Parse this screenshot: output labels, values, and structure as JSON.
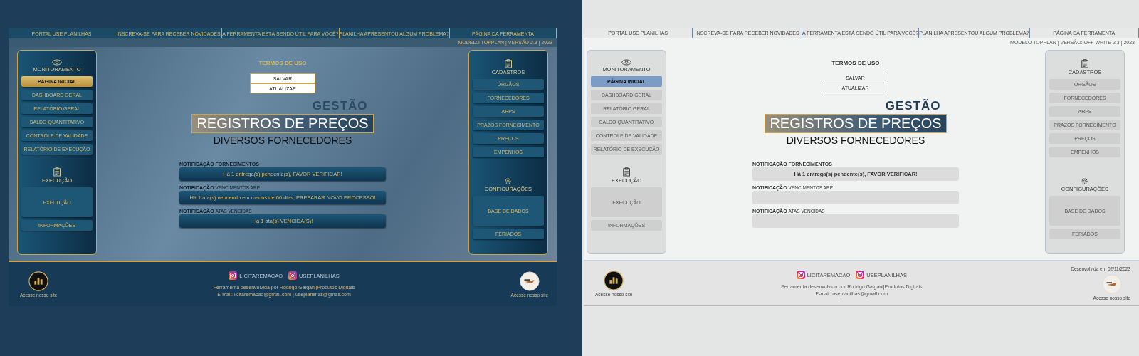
{
  "screens": [
    {
      "kind": "dark",
      "links": [
        "PORTAL USE PLANILHAS",
        "INSCREVA-SE PARA RECEBER NOVIDADES",
        "A FERRAMENTA ESTÁ SENDO ÚTIL PARA VOCÊ?",
        "PLANILHA APRESENTOU ALGUM PROBLEMA?",
        "PÁGINA DA FERRAMENTA"
      ],
      "version": "MODELO TOPPLAN | VERSÃO 2.3 | 2023",
      "monitoring": {
        "title": "MONITORAMENTO",
        "items": [
          {
            "label": "PÁGINA INICIAL",
            "selected": true
          },
          {
            "label": "DASHBOARD GERAL",
            "selected": false
          },
          {
            "label": "RELATÓRIO GERAL",
            "selected": false
          },
          {
            "label": "SALDO QUANTITATIVO",
            "selected": false
          },
          {
            "label": "CONTROLE DE VALIDADE",
            "selected": false
          },
          {
            "label": "RELATÓRIO DE EXECUÇÃO",
            "selected": false
          }
        ]
      },
      "execution": {
        "title": "EXECUÇÃO",
        "main": "EXECUÇÃO",
        "info": "INFORMAÇÕES"
      },
      "terms": "TERMOS DE USO",
      "actions": [
        "SALVAR",
        "ATUALIZAR"
      ],
      "heading": {
        "kicker": "GESTÃO",
        "title": "REGISTROS DE PREÇOS",
        "subtitle": "DIVERSOS FORNECEDORES"
      },
      "notifications": [
        {
          "label": "NOTIFICAÇÃO FORNECIMENTOS",
          "message": "Há 1 entrega(s) pendente(s), FAVOR VERIFICAR!"
        },
        {
          "label": "NOTIFICAÇÃO",
          "topic": "VENCIMENTOS ARP",
          "message": "Há 1 ata(s) vencendo em menos de 60 dias, PREPARAR NOVO PROCESSO!"
        },
        {
          "label": "NOTIFICAÇÃO",
          "topic": "ATAS VENCIDAS",
          "message": "Há 1 ata(s) VENCIDA(S)!"
        }
      ],
      "registry": {
        "title": "CADASTROS",
        "items": [
          "ÓRGÃOS",
          "FORNECEDORES",
          "ARPS",
          "PRAZOS FORNECIMENTO",
          "PREÇOS",
          "EMPENHOS"
        ]
      },
      "settings": {
        "title": "CONFIGURAÇÕES",
        "main": "BASE DE DADOS",
        "extra": "FERIADOS"
      },
      "footer": {
        "logo_caption": "Acesse nosso site",
        "social": [
          "LICITAREMACAO",
          "USEPLANILHAS"
        ],
        "credit": "Ferramenta desenvolvida por Rodrigo Galgani|Produtos Digitais",
        "email": "E-mail: licitaremacao@gmail.com | useplanilhas@gmail.com",
        "partner_caption": "Acesse nosso site"
      }
    },
    {
      "kind": "light",
      "links": [
        "PORTAL USE PLANILHAS",
        "INSCREVA-SE PARA RECEBER NOVIDADES",
        "A FERRAMENTA ESTÁ SENDO ÚTIL PARA VOCÊ?",
        "PLANILHA APRESENTOU ALGUM PROBLEMA?",
        "PÁGINA DA FERRAMENTA"
      ],
      "version": "MODELO TOPPLAN | VERSÃO: OFF WHITE 2.3 | 2023",
      "monitoring": {
        "title": "MONITORAMENTO",
        "items": [
          {
            "label": "PÁGINA INICIAL",
            "selected": true
          },
          {
            "label": "DASHBOARD GERAL",
            "selected": false
          },
          {
            "label": "RELATÓRIO GERAL",
            "selected": false
          },
          {
            "label": "SALDO QUANTITATIVO",
            "selected": false
          },
          {
            "label": "CONTROLE DE VALIDADE",
            "selected": false
          },
          {
            "label": "RELATÓRIO DE EXECUÇÃO",
            "selected": false
          }
        ]
      },
      "execution": {
        "title": "EXECUÇÃO",
        "main": "EXECUÇÃO",
        "info": "INFORMAÇÕES"
      },
      "terms": "TERMOS DE USO",
      "actions": [
        "SALVAR",
        "ATUALIZAR"
      ],
      "heading": {
        "kicker": "GESTÃO",
        "title": "REGISTROS DE PREÇOS",
        "subtitle": "DIVERSOS FORNECEDORES"
      },
      "notifications": [
        {
          "label": "NOTIFICAÇÃO FORNECIMENTOS",
          "message": "Há 1 entrega(s) pendente(s), FAVOR VERIFICAR!"
        },
        {
          "label": "NOTIFICAÇÃO",
          "topic": "VENCIMENTOS ARP"
        },
        {
          "label": "NOTIFICAÇÃO",
          "topic": "ATAS VENCIDAS"
        }
      ],
      "registry": {
        "title": "CADASTROS",
        "items": [
          "ÓRGÃOS",
          "FORNECEDORES",
          "ARPS",
          "PRAZOS FORNECIMENTO",
          "PREÇOS",
          "EMPENHOS"
        ]
      },
      "settings": {
        "title": "CONFIGURAÇÕES",
        "main": "BASE DE DADOS",
        "extra": "FERIADOS"
      },
      "footer": {
        "developed": "Desenvolvida em 02/11/2023",
        "logo_caption": "Acesse nosso site",
        "social": [
          "LICITAREMACAO",
          "USEPLANILHAS"
        ],
        "credit": "Ferramenta desenvolvida por Rodrigo Galgani|Produtos Digitais",
        "email": "E-mail: useplanilhas@gmail.com",
        "partner_caption": "Acesse nosso site"
      }
    }
  ]
}
